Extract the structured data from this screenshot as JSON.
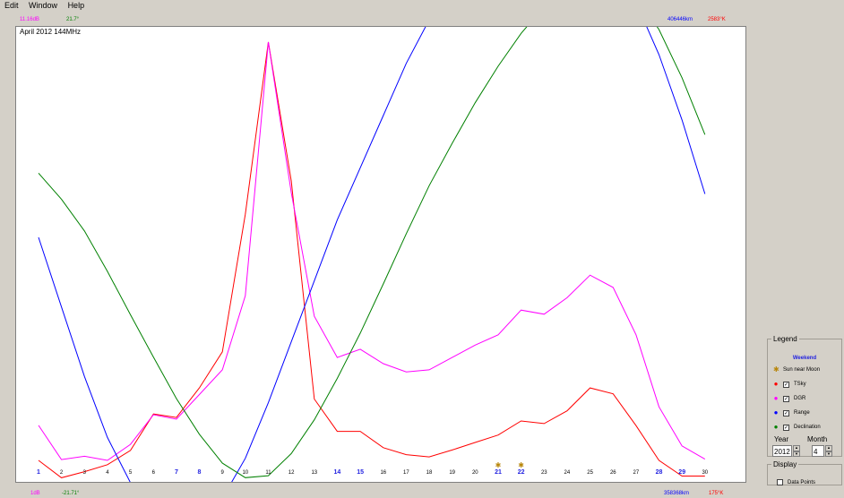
{
  "menu": [
    "Edit",
    "Window",
    "Help"
  ],
  "scale": {
    "top": {
      "dgr": "11.16dB",
      "decl": "21.7°",
      "range": "406446km",
      "tsky": "2583°K"
    },
    "bottom": {
      "dgr": "1dB",
      "decl": "-21.71°",
      "range": "358368km",
      "tsky": "175°K"
    }
  },
  "plot": {
    "title": "April 2012 144MHz"
  },
  "chart_data": {
    "type": "line",
    "title": "April 2012 144MHz",
    "x": [
      1,
      2,
      3,
      4,
      5,
      6,
      7,
      8,
      9,
      10,
      11,
      12,
      13,
      14,
      15,
      16,
      17,
      18,
      19,
      20,
      21,
      22,
      23,
      24,
      25,
      26,
      27,
      28,
      29,
      30
    ],
    "x_labels": [
      "1",
      "2",
      "3",
      "4",
      "5",
      "6",
      "7",
      "8",
      "9",
      "10",
      "11",
      "12",
      "13",
      "14",
      "15",
      "16",
      "17",
      "18",
      "19",
      "20",
      "21",
      "22",
      "23",
      "24",
      "25",
      "26",
      "27",
      "28",
      "29",
      "30"
    ],
    "weekend_days": [
      1,
      7,
      8,
      14,
      15,
      21,
      22,
      28,
      29
    ],
    "sun_near_moon_days": [
      21,
      22
    ],
    "grid": false,
    "series": [
      {
        "name": "TSky",
        "color": "#ff0000",
        "ylim": [
          175,
          2583
        ],
        "values": [
          175,
          75,
          110,
          150,
          232,
          442,
          422,
          592,
          800,
          1592,
          2583,
          1783,
          528,
          342,
          342,
          248,
          208,
          195,
          235,
          278,
          321,
          402,
          387,
          460,
          592,
          558,
          375,
          175,
          85,
          85
        ]
      },
      {
        "name": "DGR",
        "color": "#ff00ff",
        "ylim": [
          1,
          11.16
        ],
        "values": [
          1.85,
          1.02,
          1.1,
          1.0,
          1.39,
          2.11,
          2.0,
          2.6,
          3.2,
          5.0,
          11.16,
          7.5,
          4.5,
          3.5,
          3.7,
          3.35,
          3.15,
          3.2,
          3.5,
          3.8,
          4.05,
          4.65,
          4.55,
          4.95,
          5.5,
          5.2,
          4.05,
          2.3,
          1.35,
          1.03
        ]
      },
      {
        "name": "Range",
        "color": "#0000ff",
        "ylim": [
          358368,
          406446
        ],
        "values": [
          384000,
          376000,
          368000,
          361000,
          355800,
          353200,
          351500,
          352000,
          354000,
          358600,
          365000,
          372000,
          379000,
          386000,
          392000,
          398000,
          404000,
          409000,
          413000,
          416500,
          419000,
          420500,
          421000,
          420800,
          419500,
          415800,
          411000,
          405000,
          397500,
          389000
        ]
      },
      {
        "name": "Declination",
        "color": "#008000",
        "ylim": [
          -21.71,
          21.7
        ],
        "values": [
          8.1,
          5.4,
          2.1,
          -2.1,
          -6.6,
          -11.0,
          -15.3,
          -19.0,
          -22.0,
          -23.5,
          -23.3,
          -21.0,
          -17.5,
          -13.2,
          -8.5,
          -3.4,
          1.8,
          6.8,
          11.2,
          15.4,
          19.2,
          22.6,
          25.4,
          27.5,
          28.6,
          28.3,
          26.5,
          23.0,
          18.0,
          12.1
        ]
      }
    ]
  },
  "legend": {
    "title": "Legend",
    "weekend_label": "Weekend",
    "sun_label": "Sun near Moon",
    "items": [
      {
        "label": "TSky",
        "color": "#ff0000",
        "checked": true
      },
      {
        "label": "DGR",
        "color": "#ff00ff",
        "checked": true
      },
      {
        "label": "Range",
        "color": "#0000ff",
        "checked": true
      },
      {
        "label": "Declination",
        "color": "#008000",
        "checked": true
      }
    ],
    "year_label": "Year",
    "month_label": "Month",
    "year_value": "2012",
    "month_value": "4"
  },
  "display": {
    "title": "Display",
    "data_points_label": "Data Points",
    "data_points_checked": false
  },
  "colors": {
    "sun_marker": "#b8860b",
    "weekend": "#1f1fe0",
    "weekday": "#000000"
  },
  "icons": {
    "sun": "sun-icon",
    "check": "checkmark-icon"
  }
}
